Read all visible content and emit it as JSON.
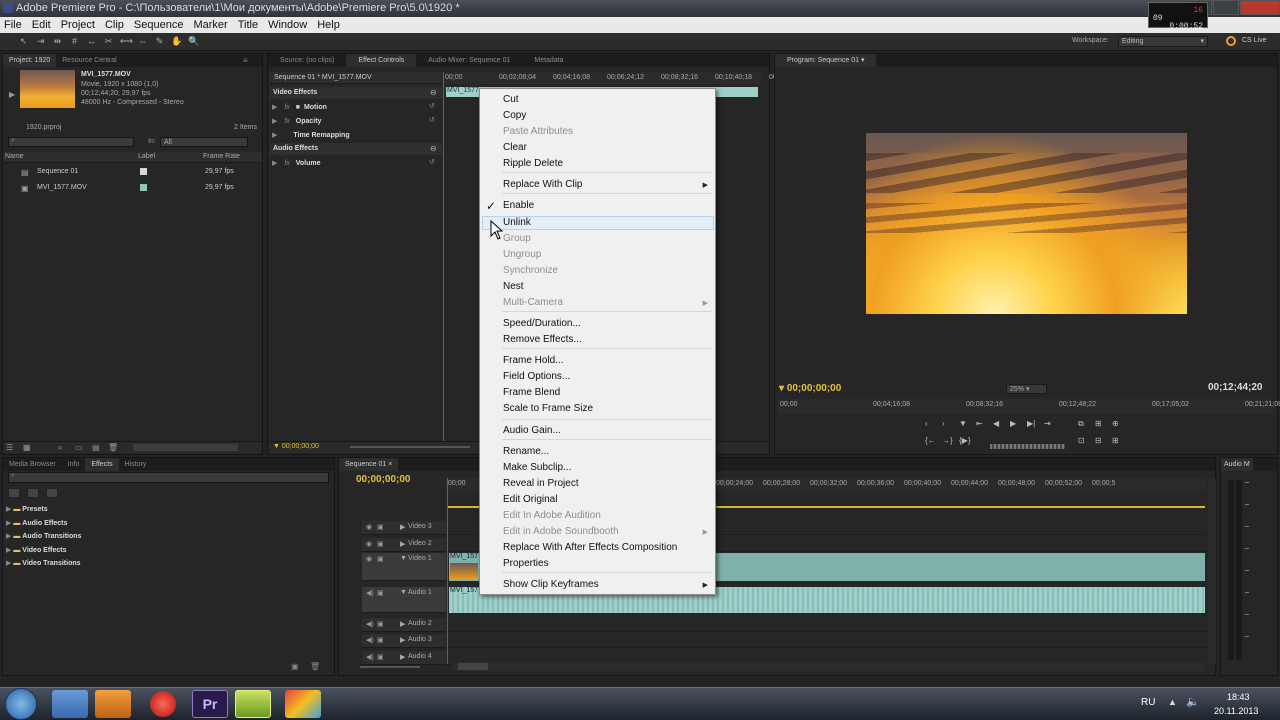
{
  "window": {
    "title": "Adobe Premiere Pro - C:\\Пользователи\\1\\Мои документы\\Adobe\\Premiere Pro\\5.0\\1920 *"
  },
  "recorder": {
    "l1": "16",
    "l2": "09",
    "l3": "0:00:52"
  },
  "menubar": [
    "File",
    "Edit",
    "Project",
    "Clip",
    "Sequence",
    "Marker",
    "Title",
    "Window",
    "Help"
  ],
  "workspace": {
    "label": "Workspace:",
    "value": "Editing",
    "cslive": "CS Live"
  },
  "project": {
    "tabs": [
      "Project: 1920",
      "Resource Central"
    ],
    "clip_name": "MVI_1577.MOV",
    "clip_info1": "Movie, 1920 x 1080 (1,0)",
    "clip_info2": "00;12;44;20, 29,97 fps",
    "clip_info3": "48000 Hz - Compressed - Stereo",
    "file": "1920.prproj",
    "count": "2 Items",
    "in_label": "In:",
    "in_value": "All",
    "columns": {
      "name": "Name",
      "label": "Label",
      "rate": "Frame Rate"
    },
    "items": [
      {
        "name": "Sequence 01",
        "rate": "29,97 fps",
        "color": "#d8d8d8"
      },
      {
        "name": "MVI_1577.MOV",
        "rate": "29,97 fps",
        "color": "#8fc9b5"
      }
    ]
  },
  "source": {
    "tabs": [
      "Source: (no clips)",
      "Effect Controls",
      "Audio Mixer: Sequence 01",
      "Metadata"
    ],
    "header": "Sequence 01 * MVI_1577.MOV",
    "ruler": [
      "00;00",
      "00;02;08;04",
      "00;04;16;08",
      "00;06;24;12",
      "00;08;32;16",
      "00;10;40;18",
      "00;1"
    ],
    "clip_label": "MVI_1577",
    "rows": [
      "Video Effects",
      "Motion",
      "Opacity",
      "Time Remapping",
      "Audio Effects",
      "Volume"
    ],
    "time": "00;00;00;00"
  },
  "program": {
    "tab": "Program: Sequence 01",
    "time_left": "00;00;00;00",
    "zoom": "25%",
    "time_right": "00;12;44;20",
    "ruler": [
      "00;00",
      "00;04;16;08",
      "00;08;32;16",
      "00;12;48;22",
      "00;17;05;02",
      "00;21;21;08"
    ]
  },
  "effects": {
    "tabs": [
      "Media Browser",
      "Info",
      "Effects",
      "History"
    ],
    "items": [
      "Presets",
      "Audio Effects",
      "Audio Transitions",
      "Video Effects",
      "Video Transitions"
    ]
  },
  "timeline": {
    "tab": "Sequence 01",
    "time": "00;00;00;00",
    "ruler_left": "00;00",
    "ruler": [
      "00;00;24;00",
      "00;00;28;00",
      "00;00;32;00",
      "00;00;36;00",
      "00;00;40;00",
      "00;00;44;00",
      "00;00;48;00",
      "00;00;52;00",
      "00;00;5"
    ],
    "tracks": [
      "Video 3",
      "Video 2",
      "Video 1",
      "Audio 1",
      "Audio 2",
      "Audio 3",
      "Audio 4"
    ],
    "clip_label": "MVI_157",
    "audio_tab": "Audio M"
  },
  "context_menu": {
    "items": [
      {
        "label": "Cut",
        "disabled": false
      },
      {
        "label": "Copy",
        "disabled": false
      },
      {
        "label": "Paste Attributes",
        "disabled": true
      },
      {
        "label": "Clear",
        "disabled": false
      },
      {
        "label": "Ripple Delete",
        "disabled": false
      },
      {
        "label": "Replace With Clip",
        "disabled": false,
        "submenu": true
      },
      {
        "label": "Enable",
        "disabled": false,
        "checked": true
      },
      {
        "label": "Unlink",
        "disabled": false,
        "highlighted": true
      },
      {
        "label": "Group",
        "disabled": true
      },
      {
        "label": "Ungroup",
        "disabled": true
      },
      {
        "label": "Synchronize",
        "disabled": true
      },
      {
        "label": "Nest",
        "disabled": false
      },
      {
        "label": "Multi-Camera",
        "disabled": true,
        "submenu": true
      },
      {
        "label": "Speed/Duration...",
        "disabled": false
      },
      {
        "label": "Remove Effects...",
        "disabled": false
      },
      {
        "label": "Frame Hold...",
        "disabled": false
      },
      {
        "label": "Field Options...",
        "disabled": false
      },
      {
        "label": "Frame Blend",
        "disabled": false
      },
      {
        "label": "Scale to Frame Size",
        "disabled": false
      },
      {
        "label": "Audio Gain...",
        "disabled": false
      },
      {
        "label": "Rename...",
        "disabled": false
      },
      {
        "label": "Make Subclip...",
        "disabled": false
      },
      {
        "label": "Reveal in Project",
        "disabled": false
      },
      {
        "label": "Edit Original",
        "disabled": false
      },
      {
        "label": "Edit In Adobe Audition",
        "disabled": true
      },
      {
        "label": "Edit in Adobe Soundbooth",
        "disabled": true,
        "submenu": true
      },
      {
        "label": "Replace With After Effects Composition",
        "disabled": false
      },
      {
        "label": "Properties",
        "disabled": false
      },
      {
        "label": "Show Clip Keyframes",
        "disabled": false,
        "submenu": true
      }
    ]
  },
  "taskbar": {
    "lang": "RU",
    "time": "18:43",
    "date": "20.11.2013",
    "pr_label": "Pr",
    "apps": [
      "start-button",
      "explorer",
      "media-player",
      "record",
      "premiere",
      "clapper",
      "paint"
    ]
  }
}
